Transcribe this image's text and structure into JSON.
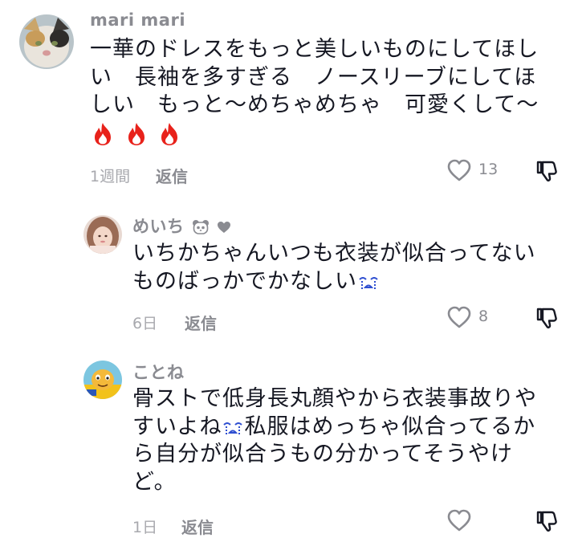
{
  "comments": [
    {
      "username": "mari mari",
      "lines": [
        "一華のドレスをもっと美しいものにしてほし",
        "い　長袖を多すぎる　ノースリーブにしてほ",
        "しい　もっと〜めちゃめちゃ　可愛くして〜"
      ],
      "emoji": [
        "fire-emoji",
        "fire-emoji",
        "fire-emoji"
      ],
      "time": "1週間",
      "reply_label": "返信",
      "likes": "13"
    },
    {
      "username": "めいち",
      "username_icons": [
        "panda-icon",
        "heart-icon"
      ],
      "lines": [
        "いちかちゃんいつも衣装が似合ってない",
        "ものばっかでかなしい"
      ],
      "line_emoji": "crying-face-icon",
      "time": "6日",
      "reply_label": "返信",
      "likes": "8"
    },
    {
      "username": "ことね",
      "lines": [
        "骨ストで低身長丸顔やから衣装事故りや",
        "すいよね",
        "私服はめっちゃ似合ってるか",
        "ら自分が似合うもの分かってそうやけ",
        "ど。"
      ],
      "line_emoji": "crying-face-icon",
      "time": "1日",
      "reply_label": "返信",
      "likes": ""
    }
  ]
}
